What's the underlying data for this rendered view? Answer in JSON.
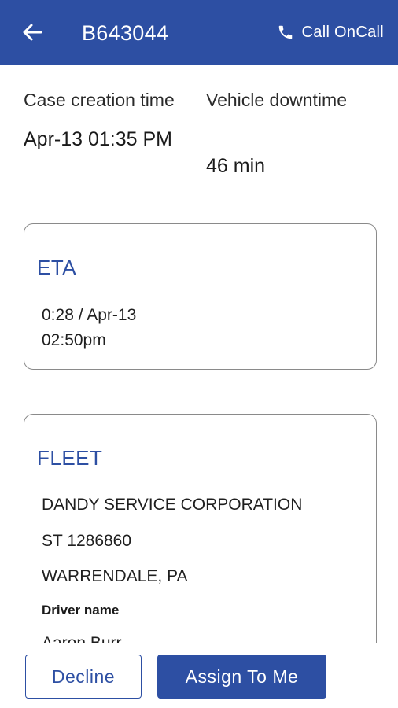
{
  "header": {
    "case_id": "B643044",
    "call_label": "Call OnCall",
    "back_icon": "arrow-left-icon",
    "call_icon": "phone-icon"
  },
  "summary": {
    "case_creation_label": "Case creation time",
    "case_creation_value": "Apr-13 01:35 PM",
    "downtime_label": "Vehicle downtime",
    "downtime_value": "46 min"
  },
  "eta": {
    "title": "ETA",
    "value": "0:28 / Apr-13 02:50pm"
  },
  "fleet": {
    "title": "FLEET",
    "company": "DANDY SERVICE CORPORATION",
    "unit": "ST 1286860",
    "location": "WARRENDALE, PA",
    "driver_label": "Driver name",
    "driver_name": "Aaron Burr"
  },
  "actions": {
    "decline_label": "Decline",
    "assign_label": "Assign To Me"
  },
  "colors": {
    "primary": "#2d4fa3",
    "card_border": "#8a8a8a"
  }
}
